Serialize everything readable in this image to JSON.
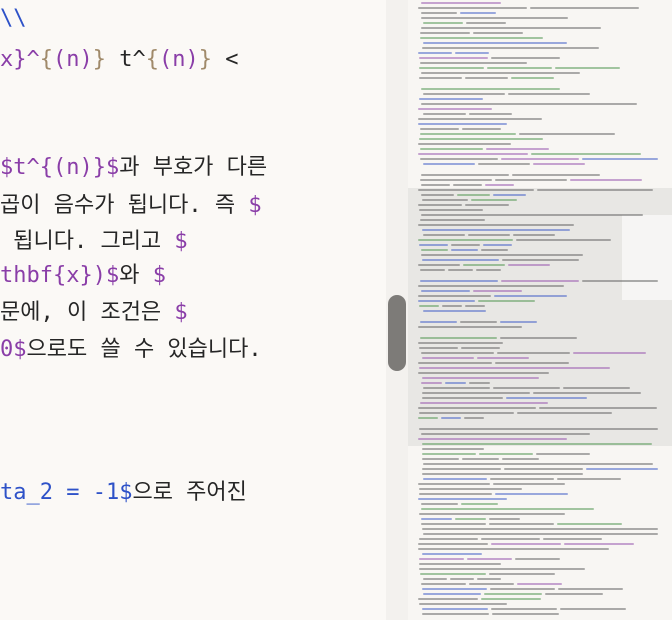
{
  "editor": {
    "lines": [
      [
        {
          "t": "\\\\",
          "c": "c-blue"
        }
      ],
      [
        {
          "t": "x}^",
          "c": "c-purple"
        },
        {
          "t": "{",
          "c": "c-paren"
        },
        {
          "t": "(n)",
          "c": "c-purple"
        },
        {
          "t": "}",
          "c": "c-paren"
        },
        {
          "t": " t^",
          "c": "c-normal"
        },
        {
          "t": "{",
          "c": "c-paren"
        },
        {
          "t": "(n)",
          "c": "c-purple"
        },
        {
          "t": "}",
          "c": "c-paren"
        },
        {
          "t": " <",
          "c": "c-normal"
        }
      ],
      [
        {
          "t": "$t^{(n)}$",
          "c": "c-purple"
        },
        {
          "t": "과 부호가 다른",
          "c": "c-normal"
        }
      ],
      [
        {
          "t": "곱이 음수가 됩니다. 즉 ",
          "c": "c-normal"
        },
        {
          "t": "$",
          "c": "c-purple"
        }
      ],
      [
        {
          "t": " 됩니다. 그리고 ",
          "c": "c-normal"
        },
        {
          "t": "$",
          "c": "c-purple"
        }
      ],
      [
        {
          "t": "thbf{x})$",
          "c": "c-purple"
        },
        {
          "t": "와 ",
          "c": "c-normal"
        },
        {
          "t": "$",
          "c": "c-purple"
        }
      ],
      [
        {
          "t": "문에, 이 조건은 ",
          "c": "c-normal"
        },
        {
          "t": "$",
          "c": "c-purple"
        }
      ],
      [
        {
          "t": "0$",
          "c": "c-purple"
        },
        {
          "t": "으로도 쓸 수 있습니다.",
          "c": "c-normal"
        }
      ],
      [
        {
          "t": "ta_2 = -1$",
          "c": "c-blue"
        },
        {
          "t": "으로 주어진",
          "c": "c-normal"
        }
      ]
    ]
  },
  "minimap": {
    "colors": {
      "text": "#6a6a6a",
      "purple": "#9a5cb0",
      "blue": "#4a66c8",
      "green": "#5a9a5a"
    }
  }
}
